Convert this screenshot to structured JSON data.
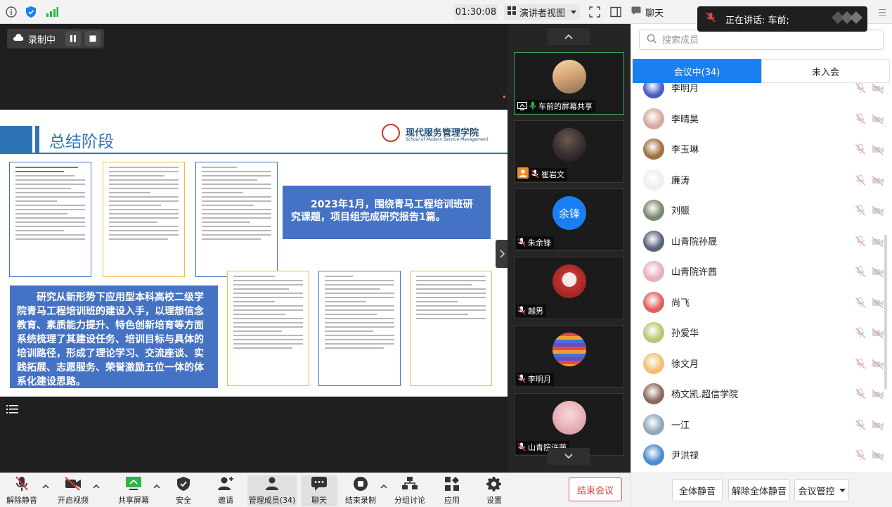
{
  "topbar": {
    "timer": "01:30:08",
    "view_mode": "演讲者视图",
    "chat_label": "聊天",
    "speaking_label": "正在讲话: 车前;"
  },
  "share": {
    "recording_label": "录制中",
    "slide": {
      "title": "总结阶段",
      "college_name": "现代服务管理学院",
      "college_name_en": "School of Modern Service Management",
      "box_right": "2023年1月，围绕青马工程培训班研究课题，项目组完成研究报告1篇。",
      "box_left": "研究从新形势下应用型本科高校二级学院青马工程培训班的建设入手，以理想信念教育、素质能力提升、特色创新培育等方面系统梳理了其建设任务、培训目标与具体的培训路径，形成了理论学习、交流座谈、实践拓展、志愿服务、荣誉激励五位一体的体系化建设思路。"
    }
  },
  "strip": {
    "tiles": [
      {
        "name": "车前的屏幕共享",
        "avatar_color": "#d8a878"
      },
      {
        "name": "崔岩文",
        "avatar_color": "#3a3230"
      },
      {
        "name": "朱余锋",
        "avatar_text": "余锋",
        "avatar_color": "#1a7ff0"
      },
      {
        "name": "越男",
        "avatar_color": "#c23434"
      },
      {
        "name": "李明月",
        "avatar_color": "#5a6fd0"
      },
      {
        "name": "山青院许茜",
        "avatar_color": "#e8b0b8"
      }
    ]
  },
  "panel": {
    "search_placeholder": "搜索成员",
    "tab_in": "会议中(34)",
    "tab_out": "未入会",
    "members": [
      {
        "name": "李明月",
        "color": "#4a5cc0"
      },
      {
        "name": "李晴昊",
        "color": "#d8a8a0"
      },
      {
        "name": "李玉琳",
        "color": "#a07040"
      },
      {
        "name": "廉涛",
        "color": "#eeeeee"
      },
      {
        "name": "刘赈",
        "color": "#7a8a70"
      },
      {
        "name": "山青院孙晟",
        "color": "#5a6478"
      },
      {
        "name": "山青院许茜",
        "color": "#e8b0b8"
      },
      {
        "name": "尚飞",
        "color": "#e06060"
      },
      {
        "name": "孙爱华",
        "color": "#b8c870"
      },
      {
        "name": "徐文月",
        "color": "#f0c070"
      },
      {
        "name": "杨文凯.超信学院",
        "color": "#8a6a60"
      },
      {
        "name": "一江",
        "color": "#90a8b8"
      },
      {
        "name": "尹洪禄",
        "color": "#4a8ad0"
      }
    ],
    "footer": {
      "mute_all": "全体静音",
      "unmute_all": "解除全体静音",
      "meeting_control": "会议管控"
    }
  },
  "toolbar": {
    "unmute": "解除静音",
    "video": "开启视频",
    "share": "共享屏幕",
    "security": "安全",
    "invite": "邀请",
    "members": "管理成员(34)",
    "chat": "聊天",
    "end_recording": "结束录制",
    "breakout": "分组讨论",
    "apps": "应用",
    "settings": "设置",
    "end_meeting": "结束会议"
  }
}
